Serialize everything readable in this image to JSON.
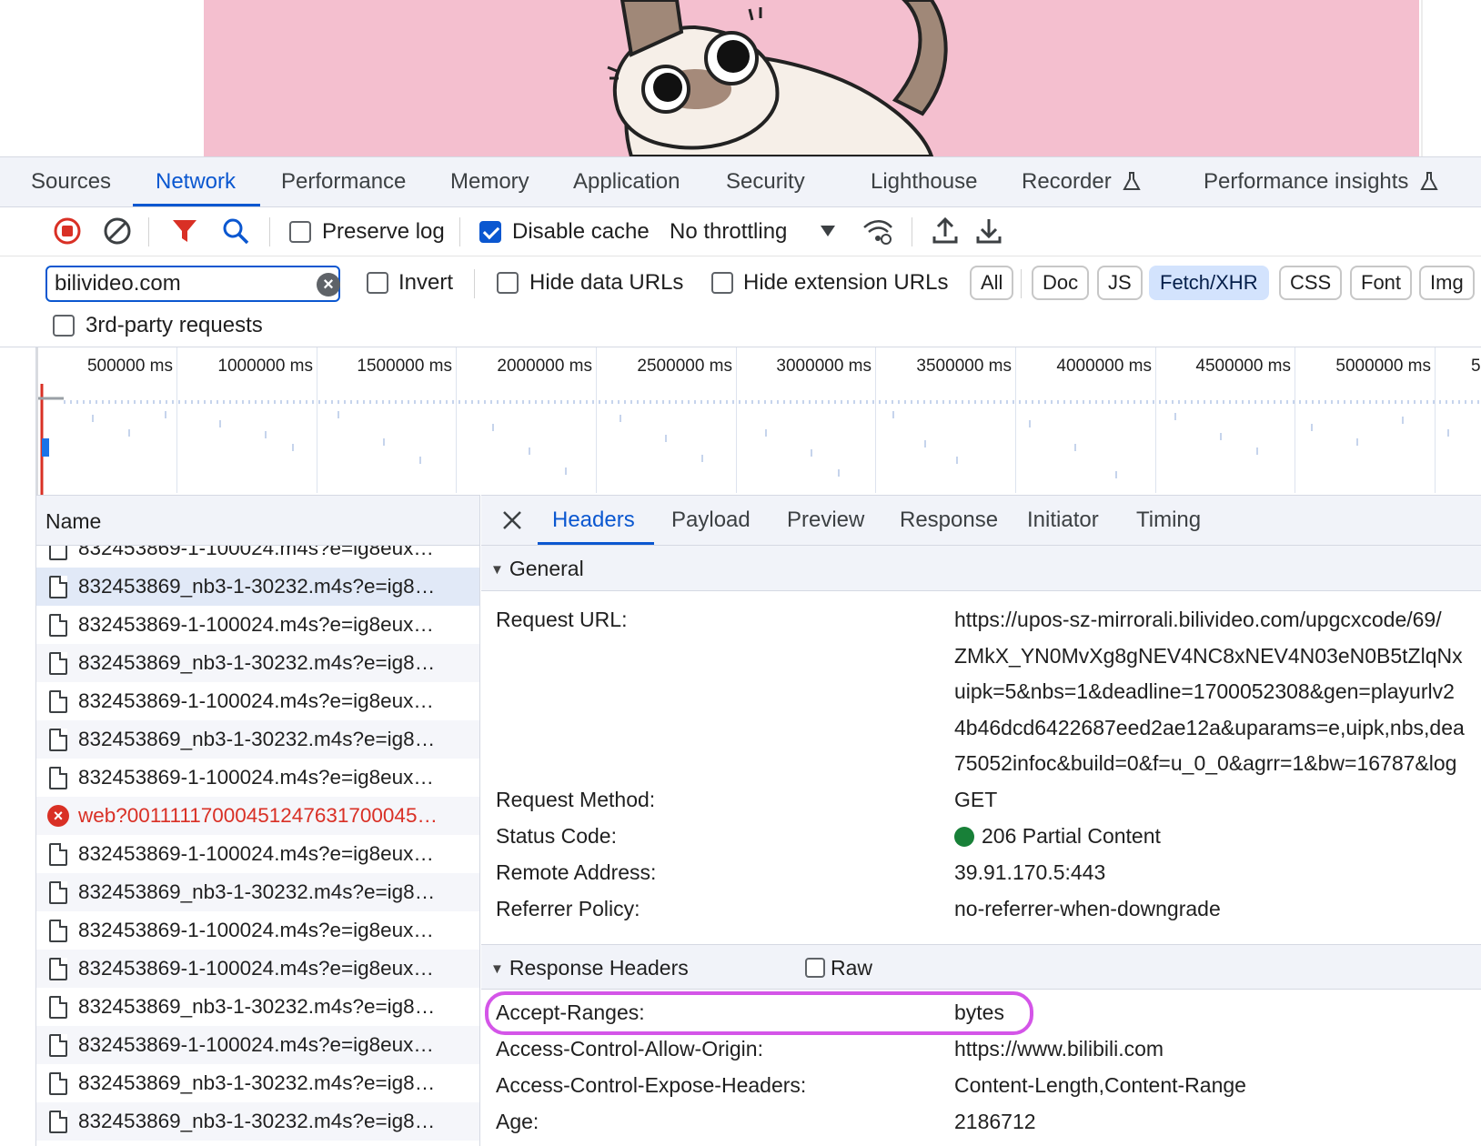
{
  "panel_tabs": [
    "Sources",
    "Network",
    "Performance",
    "Memory",
    "Application",
    "Security",
    "Lighthouse",
    "Recorder",
    "Performance insights"
  ],
  "toolbar": {
    "preserve_log": "Preserve log",
    "disable_cache": "Disable cache",
    "throttling": "No throttling"
  },
  "filter": {
    "value": "bilivideo.com",
    "invert": "Invert",
    "hide_data_urls": "Hide data URLs",
    "hide_extension_urls": "Hide extension URLs",
    "third_party": "3rd-party requests",
    "types": [
      "All",
      "Doc",
      "JS",
      "Fetch/XHR",
      "CSS",
      "Font",
      "Img"
    ],
    "active_type": "Fetch/XHR"
  },
  "overview": {
    "ticks": [
      "500000 ms",
      "1000000 ms",
      "1500000 ms",
      "2000000 ms",
      "2500000 ms",
      "3000000 ms",
      "3500000 ms",
      "4000000 ms",
      "4500000 ms",
      "5000000 ms",
      "5"
    ]
  },
  "list": {
    "header": "Name",
    "rows": [
      "832453869-1-100024.m4s?e=ig8eux…",
      "832453869_nb3-1-30232.m4s?e=ig8…",
      "832453869-1-100024.m4s?e=ig8eux…",
      "832453869_nb3-1-30232.m4s?e=ig8…",
      "832453869-1-100024.m4s?e=ig8eux…",
      "832453869_nb3-1-30232.m4s?e=ig8…",
      "832453869-1-100024.m4s?e=ig8eux…",
      "web?00111117000451247631700045…",
      "832453869-1-100024.m4s?e=ig8eux…",
      "832453869_nb3-1-30232.m4s?e=ig8…",
      "832453869-1-100024.m4s?e=ig8eux…",
      "832453869-1-100024.m4s?e=ig8eux…",
      "832453869_nb3-1-30232.m4s?e=ig8…",
      "832453869-1-100024.m4s?e=ig8eux…",
      "832453869_nb3-1-30232.m4s?e=ig8…",
      "832453869_nb3-1-30232.m4s?e=ig8…"
    ]
  },
  "detail_tabs": [
    "Headers",
    "Payload",
    "Preview",
    "Response",
    "Initiator",
    "Timing"
  ],
  "general": {
    "title": "General",
    "request_url_key": "Request URL:",
    "request_url_lines": [
      "https://upos-sz-mirrorali.bilivideo.com/upgcxcode/69/",
      "ZMkX_YN0MvXg8gNEV4NC8xNEV4N03eN0B5tZlqNx",
      "uipk=5&nbs=1&deadline=1700052308&gen=playurlv2",
      "4b46dcd6422687eed2ae12a&uparams=e,uipk,nbs,dea",
      "75052infoc&build=0&f=u_0_0&agrr=1&bw=16787&log"
    ],
    "method_key": "Request Method:",
    "method": "GET",
    "status_key": "Status Code:",
    "status": "206 Partial Content",
    "remote_key": "Remote Address:",
    "remote": "39.91.170.5:443",
    "referrer_key": "Referrer Policy:",
    "referrer": "no-referrer-when-downgrade"
  },
  "response_headers": {
    "title": "Response Headers",
    "raw": "Raw",
    "items": [
      {
        "key": "Accept-Ranges:",
        "value": "bytes"
      },
      {
        "key": "Access-Control-Allow-Origin:",
        "value": "https://www.bilibili.com"
      },
      {
        "key": "Access-Control-Expose-Headers:",
        "value": "Content-Length,Content-Range"
      },
      {
        "key": "Age:",
        "value": "2186712"
      }
    ]
  },
  "colors": {
    "accent": "#0b57d0",
    "error": "#d93025",
    "status_ok": "#188038",
    "highlight": "#d455e8",
    "hero_bg": "#f4bfcf"
  }
}
